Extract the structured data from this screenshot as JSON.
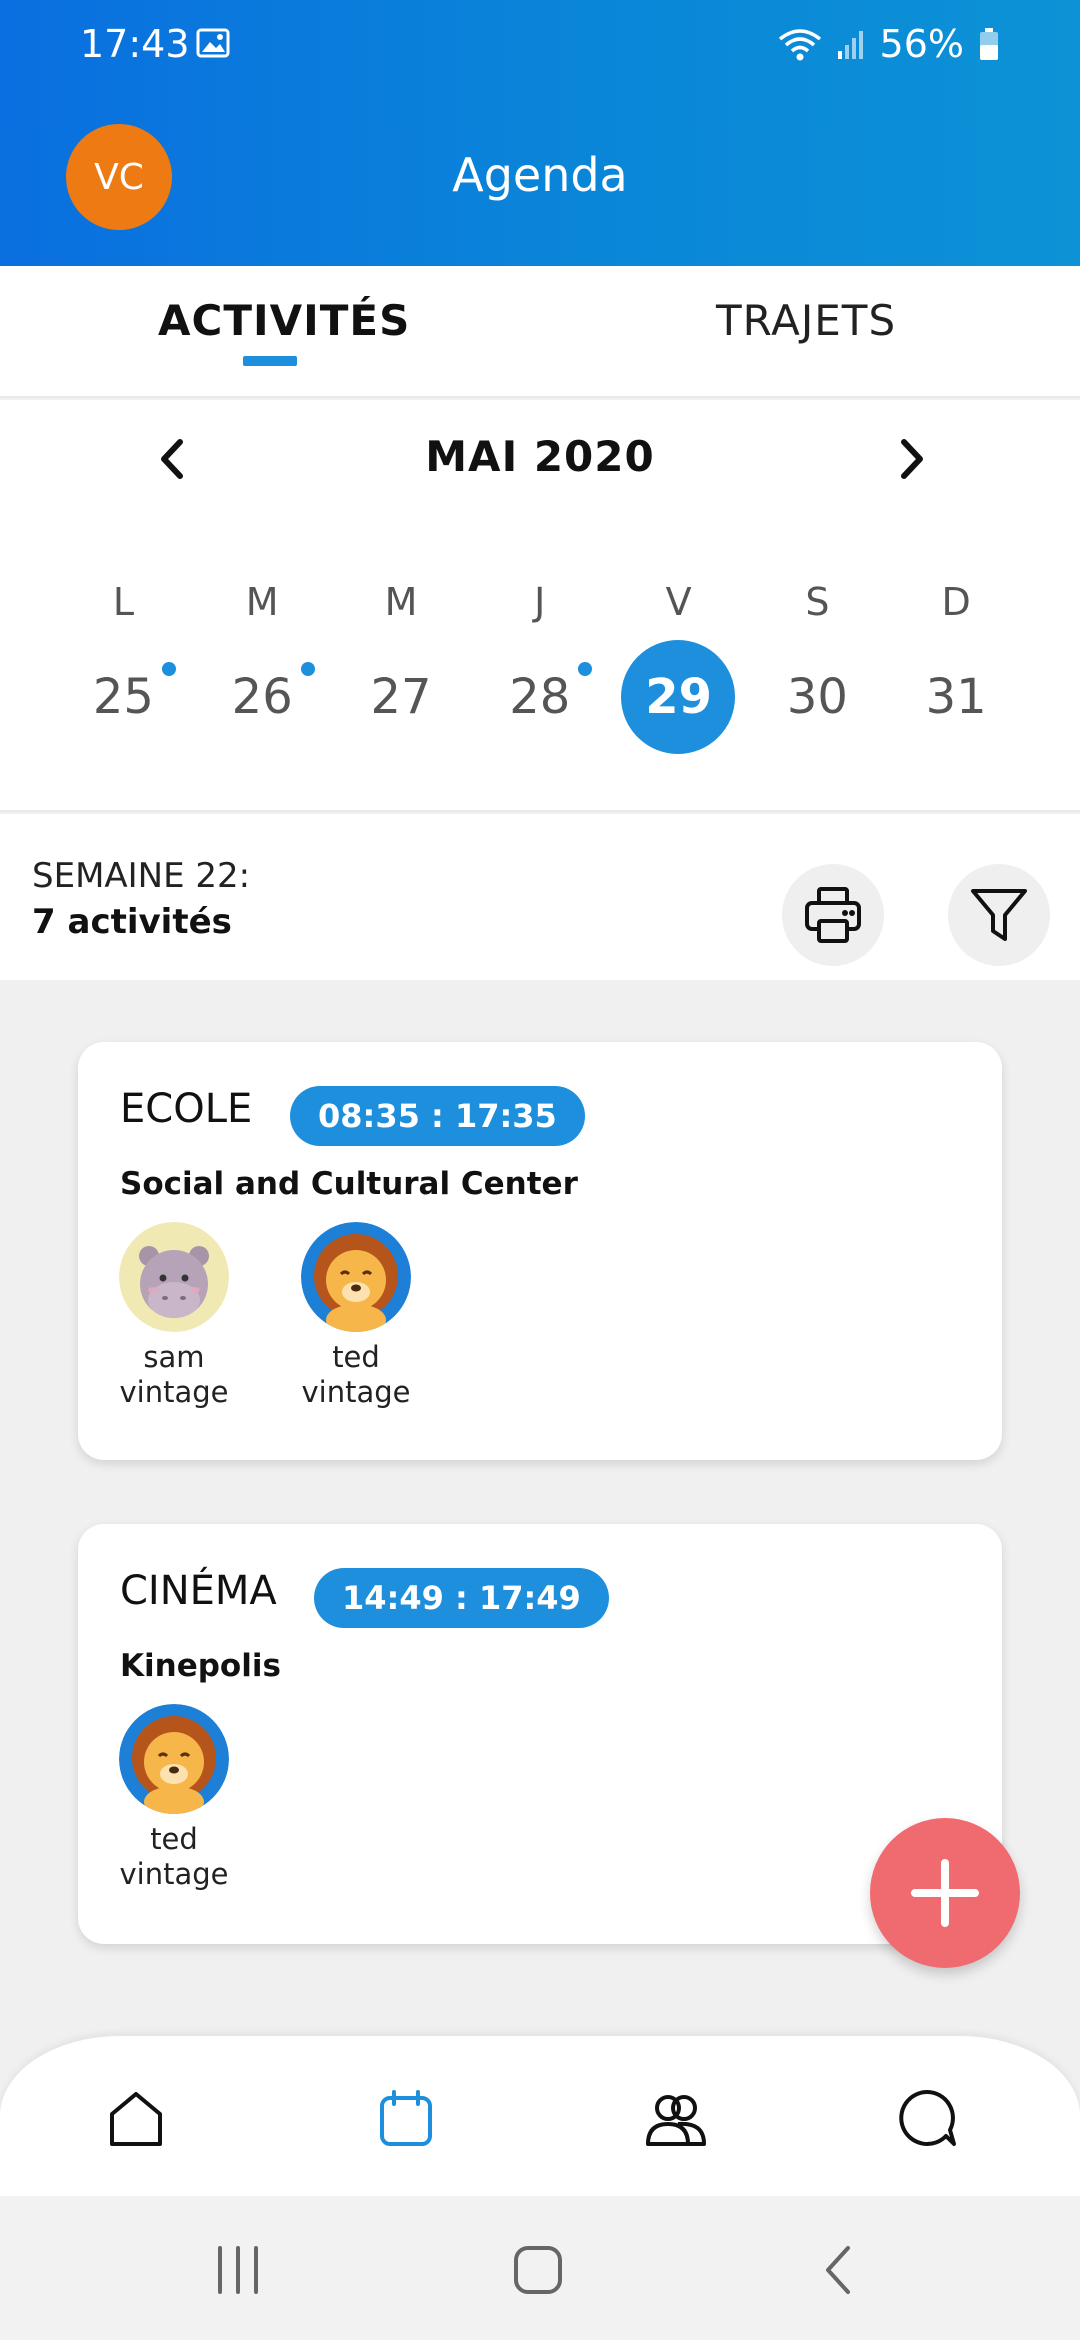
{
  "status_bar": {
    "time": "17:43",
    "battery": "56%"
  },
  "header": {
    "avatar_initials": "VC",
    "title": "Agenda"
  },
  "tabs": [
    {
      "label": "ACTIVITÉS",
      "active": true
    },
    {
      "label": "TRAJETS",
      "active": false
    }
  ],
  "calendar": {
    "month": "MAI 2020",
    "weekdays": [
      "L",
      "M",
      "M",
      "J",
      "V",
      "S",
      "D"
    ],
    "dates": [
      {
        "day": "25",
        "has_event": true
      },
      {
        "day": "26",
        "has_event": true
      },
      {
        "day": "27",
        "has_event": false
      },
      {
        "day": "28",
        "has_event": true
      },
      {
        "day": "29",
        "has_event": false,
        "selected": true
      },
      {
        "day": "30",
        "has_event": false
      },
      {
        "day": "31",
        "has_event": false
      }
    ],
    "accent_color": "#1e8fdc"
  },
  "week_summary": {
    "label": "SEMAINE 22:",
    "count": "7 activités"
  },
  "activities": [
    {
      "title": "ECOLE",
      "time": "08:35 : 17:35",
      "location": "Social and Cultural Center",
      "participants": [
        {
          "name_line1": "sam",
          "name_line2": "vintage",
          "avatar": "hippo-avatar"
        },
        {
          "name_line1": "ted",
          "name_line2": "vintage",
          "avatar": "lion-avatar"
        }
      ]
    },
    {
      "title": "CINÉMA",
      "time": "14:49 : 17:49",
      "location": "Kinepolis",
      "participants": [
        {
          "name_line1": "ted",
          "name_line2": "vintage",
          "avatar": "lion-avatar"
        }
      ]
    }
  ],
  "fab": {
    "icon": "plus-icon",
    "color": "#f06b6f"
  },
  "bottom_nav": [
    {
      "icon": "home-icon",
      "active": false
    },
    {
      "icon": "calendar-icon",
      "active": true
    },
    {
      "icon": "group-icon",
      "active": false
    },
    {
      "icon": "chat-icon",
      "active": false
    }
  ]
}
